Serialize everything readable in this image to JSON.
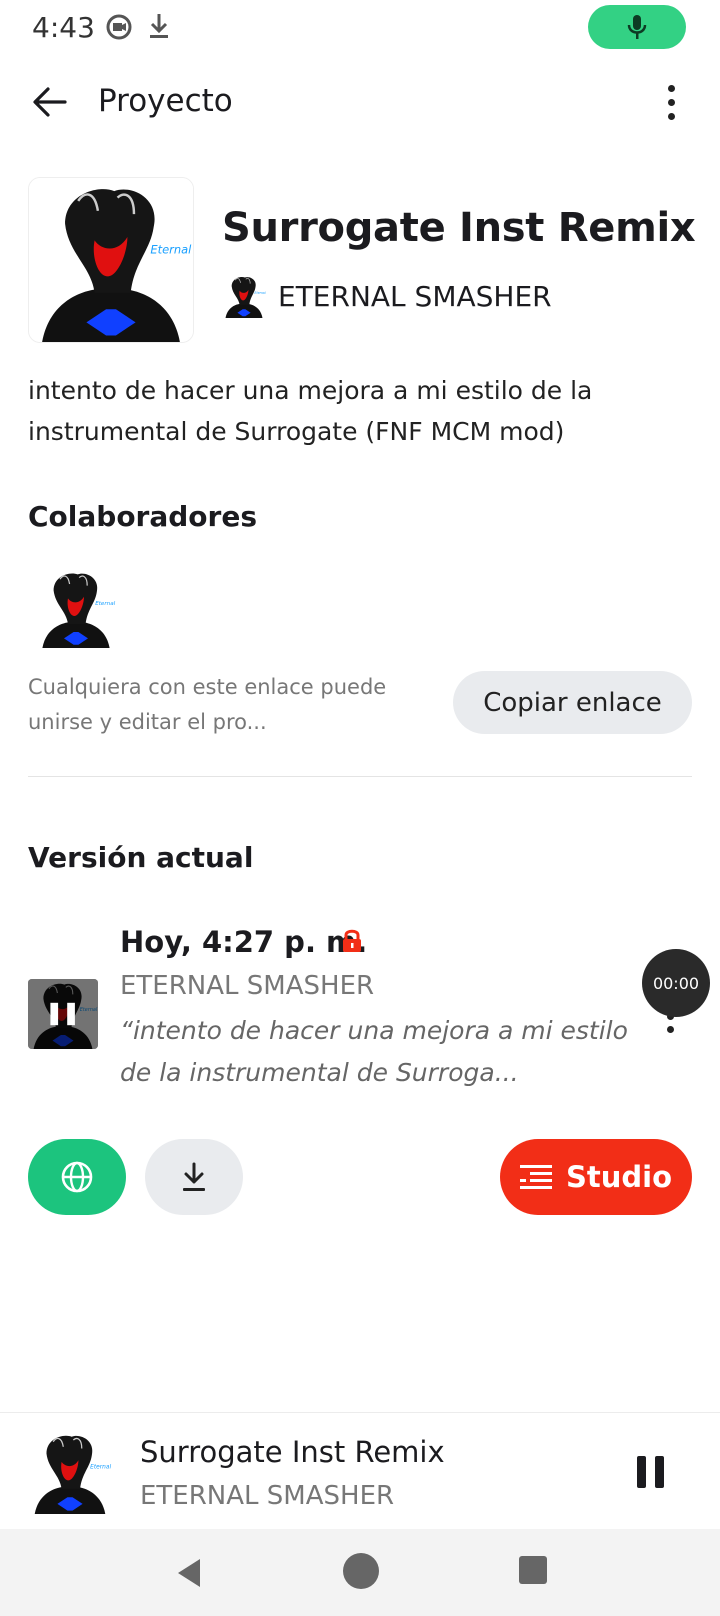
{
  "status_bar": {
    "time": "4:43",
    "icons": [
      "screen-record-icon",
      "download-icon",
      "microphone-icon"
    ],
    "mic_color": "#33d184"
  },
  "top_bar": {
    "title": "Proyecto",
    "back_icon": "arrow-left-icon",
    "more_icon": "more-vertical-icon"
  },
  "project": {
    "title": "Surrogate Inst Remix",
    "author": "ETERNAL SMASHER",
    "description": "intento de hacer una mejora a mi estilo de la instrumental de Surrogate (FNF MCM mod)"
  },
  "collaborators": {
    "title": "Colaboradores",
    "share_text": "Cualquiera con este enlace puede unirse y editar el pro...",
    "copy_label": "Copiar enlace"
  },
  "version": {
    "title": "Versión actual",
    "date": "Hoy, 4:27 p. m.",
    "author": "ETERNAL SMASHER",
    "note": "“intento de hacer una mejora a mi estilo de la instrumental de Surroga...",
    "timer": "00:00",
    "lock_color": "#f22e17"
  },
  "actions": {
    "publish_icon": "globe-icon",
    "download_icon": "download-icon",
    "studio_label": "Studio",
    "studio_color": "#f22e17",
    "publish_color": "#1cc47e"
  },
  "mini_player": {
    "title": "Surrogate Inst Remix",
    "author": "ETERNAL SMASHER",
    "state_icon": "pause-icon"
  },
  "nav": {
    "icons": [
      "nav-back-icon",
      "nav-home-icon",
      "nav-recents-icon"
    ]
  }
}
